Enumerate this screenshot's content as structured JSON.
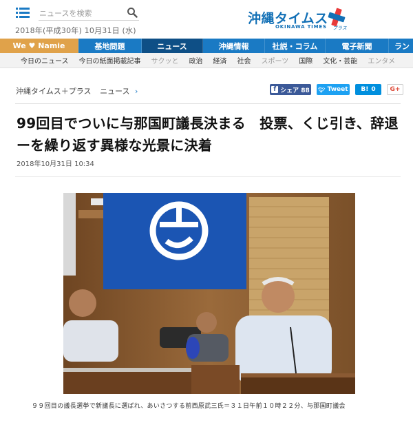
{
  "header": {
    "search_placeholder": "ニュースを検索",
    "date": "2018年(平成30年) 10月31日 (水)",
    "logo_main": "沖縄タイムス",
    "logo_sub": "OKINAWA TIMES",
    "logo_plus": "プラス",
    "brand_color": "#1270b6"
  },
  "nav": {
    "items": [
      "We ♥ Namie",
      "基地問題",
      "ニュース",
      "沖縄情報",
      "社説・コラム",
      "電子新聞",
      "ラン"
    ],
    "active": "ニュース"
  },
  "subnav": {
    "items": [
      "今日のニュース",
      "今日の紙面掲載記事",
      "サクッと",
      "政治",
      "経済",
      "社会",
      "スポーツ",
      "国際",
      "文化・芸能",
      "エンタメ"
    ]
  },
  "breadcrumb": {
    "site": "沖縄タイムス＋プラス",
    "section": "ニュース"
  },
  "share": {
    "facebook": "シェア 88",
    "twitter": "Tweet",
    "hatena": "0",
    "gplus": "G+"
  },
  "article": {
    "title": "99回目でついに与那国町議長決まる　投票、くじ引き、辞退ーを繰り返す異様な光景に決着",
    "published": "2018年10月31日 10:34",
    "caption": "９９回目の議長選挙で新議長に選ばれ、あいさつする前西原武三氏＝３１日午前１０時２２分、与那国町議会"
  }
}
